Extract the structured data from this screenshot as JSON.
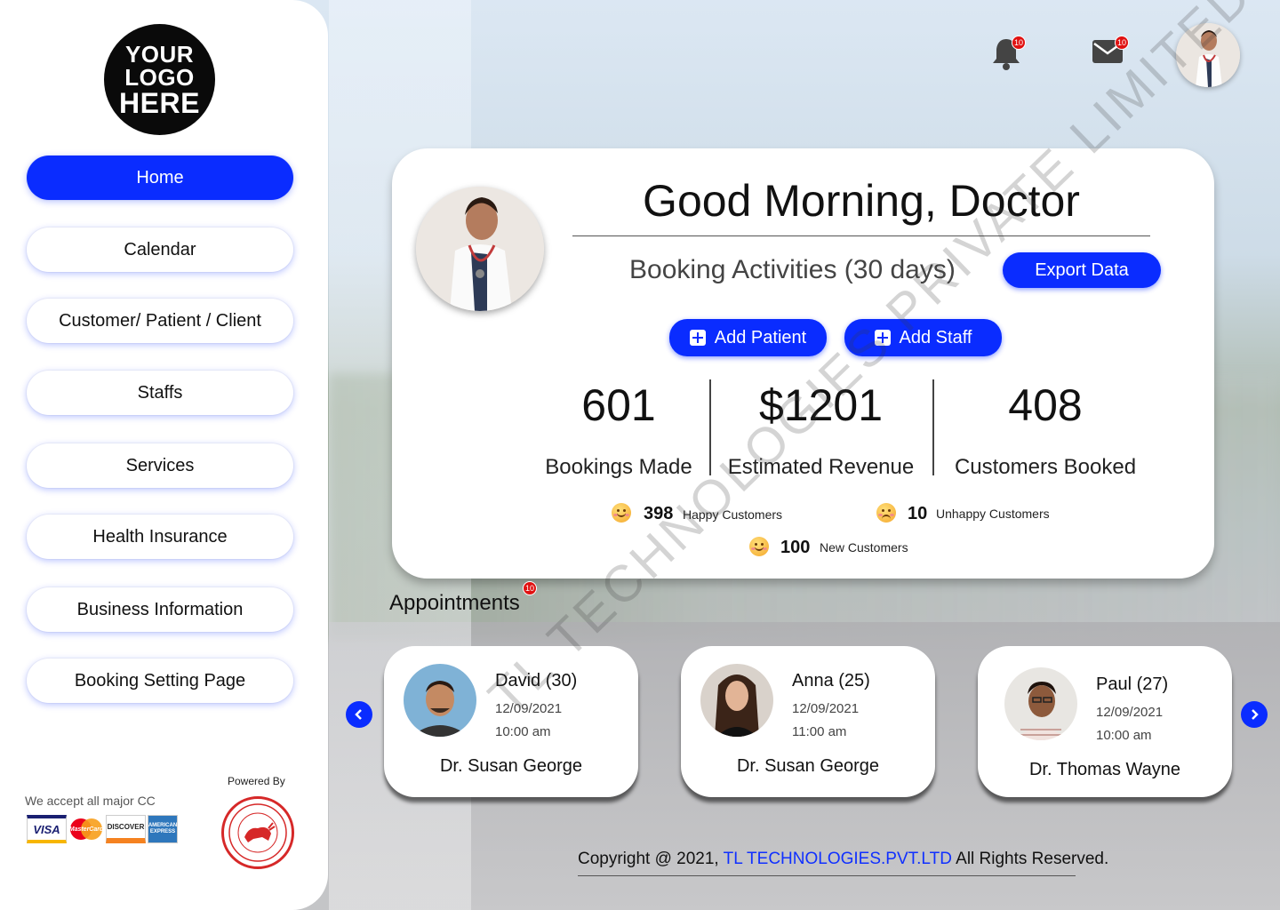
{
  "logo": {
    "lines": [
      "YOUR",
      "LOGO",
      "HERE"
    ]
  },
  "sidebar": {
    "items": [
      {
        "label": "Home",
        "active": true
      },
      {
        "label": "Calendar"
      },
      {
        "label": "Customer/ Patient / Client"
      },
      {
        "label": "Staffs"
      },
      {
        "label": "Services"
      },
      {
        "label": "Health Insurance"
      },
      {
        "label": "Business Information"
      },
      {
        "label": "Booking Setting Page"
      }
    ],
    "cc_label": "We accept all major CC",
    "cards": [
      "VISA",
      "MasterCard",
      "DISCOVER",
      "AMERICAN EXPRESS"
    ],
    "powered_by": "Powered By"
  },
  "topbar": {
    "notifications_count": "10",
    "messages_count": "10"
  },
  "dashboard": {
    "greeting": "Good Morning, Doctor",
    "booking_activities": "Booking Activities (30 days)",
    "export_label": "Export Data",
    "add_patient_label": "Add Patient",
    "add_staff_label": "Add Staff",
    "stats": [
      {
        "value": "601",
        "label": "Bookings Made"
      },
      {
        "value": "$1201",
        "label": "Estimated Revenue"
      },
      {
        "value": "408",
        "label": "Customers Booked"
      }
    ],
    "happy": {
      "count": "398",
      "label": "Happy Customers"
    },
    "unhappy": {
      "count": "10",
      "label": "Unhappy Customers"
    },
    "new": {
      "count": "100",
      "label": "New Customers"
    }
  },
  "appointments": {
    "title": "Appointments",
    "badge": "10",
    "items": [
      {
        "name": "David (30)",
        "date": "12/09/2021",
        "time": "10:00 am",
        "doctor": "Dr. Susan George"
      },
      {
        "name": "Anna (25)",
        "date": "12/09/2021",
        "time": "11:00 am",
        "doctor": "Dr. Susan George"
      },
      {
        "name": "Paul (27)",
        "date": "12/09/2021",
        "time": "10:00 am",
        "doctor": "Dr. Thomas Wayne"
      }
    ]
  },
  "footer": {
    "prefix": "Copyright @ 2021, ",
    "brand": "TL TECHNOLOGIES.PVT.LTD",
    "suffix": " All Rights Reserved."
  },
  "watermark": "TL TECHNOLOGIES PRIVATE LIMITED",
  "colors": {
    "accent": "#0a2cff",
    "badge": "#e01111",
    "brand_link": "#1030ff"
  }
}
